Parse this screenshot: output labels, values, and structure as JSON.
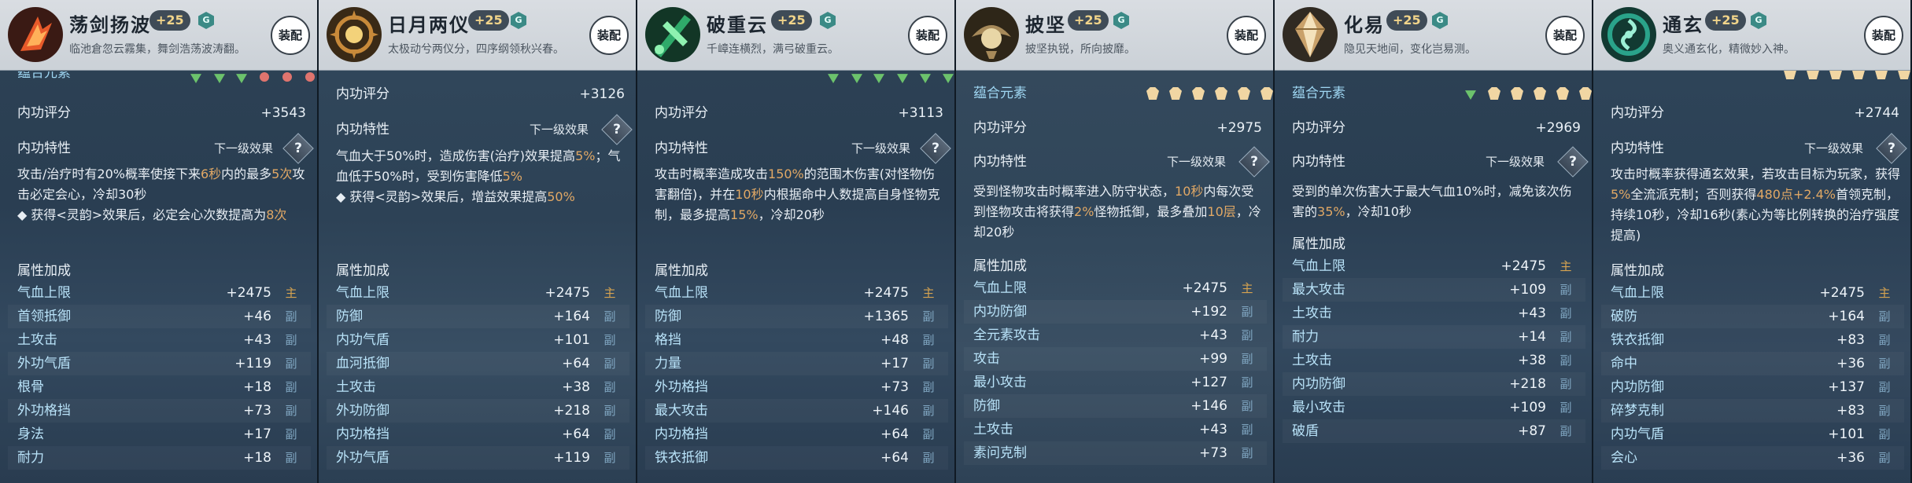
{
  "panels": [
    {
      "name": "荡剑扬波",
      "level": "+25",
      "gem": "G",
      "desc": "临池倉忽云霧集，舞剑浩荡波涛翻。",
      "equip": "装配",
      "elements_label": "蕴合元素",
      "score_label": "内功评分",
      "score": "+3543",
      "trait_label": "内功特性",
      "next_label": "下一级效果",
      "trait_text": "攻击/治疗时有20%概率使接下来6秒内的最多5次攻击必定会心，冷却30秒\n◆ 获得<灵韵>效果后，必定会心次数提高为8次",
      "attr_title": "属性加成",
      "attrs": [
        {
          "label": "气血上限",
          "value": "+2475",
          "tag": "主"
        },
        {
          "label": "首领抵御",
          "value": "+46",
          "tag": "副"
        },
        {
          "label": "土攻击",
          "value": "+43",
          "tag": "副"
        },
        {
          "label": "外功气盾",
          "value": "+119",
          "tag": "副"
        },
        {
          "label": "根骨",
          "value": "+18",
          "tag": "副"
        },
        {
          "label": "外功格挡",
          "value": "+73",
          "tag": "副"
        },
        {
          "label": "身法",
          "value": "+17",
          "tag": "副"
        },
        {
          "label": "耐力",
          "value": "+18",
          "tag": "副"
        }
      ],
      "colors": {
        "icon_a": "#e85a2a",
        "icon_b": "#ffb15a"
      }
    },
    {
      "name": "日月两仪",
      "level": "+25",
      "gem": "G",
      "desc": "太极动兮两仪分，四序纲领秋兴春。",
      "equip": "装配",
      "score_label": "内功评分",
      "score": "+3126",
      "trait_label": "内功特性",
      "next_label": "下一级效果",
      "trait_text": "气血大于50%时，造成伤害(治疗)效果提高5%；气血低于50%时，受到伤害降低5%\n◆ 获得<灵韵>效果后，增益效果提高50%",
      "attr_title": "属性加成",
      "attrs": [
        {
          "label": "气血上限",
          "value": "+2475",
          "tag": "主"
        },
        {
          "label": "防御",
          "value": "+164",
          "tag": "副"
        },
        {
          "label": "内功气盾",
          "value": "+101",
          "tag": "副"
        },
        {
          "label": "血河抵御",
          "value": "+64",
          "tag": "副"
        },
        {
          "label": "土攻击",
          "value": "+38",
          "tag": "副"
        },
        {
          "label": "外功防御",
          "value": "+218",
          "tag": "副"
        },
        {
          "label": "内功格挡",
          "value": "+64",
          "tag": "副"
        },
        {
          "label": "外功气盾",
          "value": "+119",
          "tag": "副"
        }
      ],
      "colors": {
        "icon_a": "#c88a3a",
        "icon_b": "#f3d27a"
      }
    },
    {
      "name": "破重云",
      "level": "+25",
      "gem": "G",
      "desc": "千嶂连横烈，满弓破重云。",
      "equip": "装配",
      "score_label": "内功评分",
      "score": "+3113",
      "trait_label": "内功特性",
      "next_label": "下一级效果",
      "trait_text": "攻击时概率造成攻击150%的范围木伤害(对怪物伤害翻倍)，并在10秒内根据命中人数提高自身怪物克制，最多提高15%，冷却20秒",
      "attr_title": "属性加成",
      "attrs": [
        {
          "label": "气血上限",
          "value": "+2475",
          "tag": "主"
        },
        {
          "label": "防御",
          "value": "+1365",
          "tag": "副"
        },
        {
          "label": "格挡",
          "value": "+48",
          "tag": "副"
        },
        {
          "label": "力量",
          "value": "+17",
          "tag": "副"
        },
        {
          "label": "外功格挡",
          "value": "+73",
          "tag": "副"
        },
        {
          "label": "最大攻击",
          "value": "+146",
          "tag": "副"
        },
        {
          "label": "内功格挡",
          "value": "+64",
          "tag": "副"
        },
        {
          "label": "铁衣抵御",
          "value": "+64",
          "tag": "副"
        }
      ],
      "colors": {
        "icon_a": "#2faa6a",
        "icon_b": "#8ef2b0"
      }
    },
    {
      "name": "披坚",
      "level": "+25",
      "gem": "G",
      "desc": "披坚执锐，所向披靡。",
      "equip": "装配",
      "elements_label": "蕴合元素",
      "score_label": "内功评分",
      "score": "+2975",
      "trait_label": "内功特性",
      "next_label": "下一级效果",
      "trait_text": "受到怪物攻击时概率进入防守状态，10秒内每次受到怪物攻击将获得2%怪物抵御，最多叠加10层，冷却20秒",
      "attr_title": "属性加成",
      "attrs": [
        {
          "label": "气血上限",
          "value": "+2475",
          "tag": "主"
        },
        {
          "label": "内功防御",
          "value": "+192",
          "tag": "副"
        },
        {
          "label": "全元素攻击",
          "value": "+43",
          "tag": "副"
        },
        {
          "label": "攻击",
          "value": "+99",
          "tag": "副"
        },
        {
          "label": "最小攻击",
          "value": "+127",
          "tag": "副"
        },
        {
          "label": "防御",
          "value": "+146",
          "tag": "副"
        },
        {
          "label": "土攻击",
          "value": "+43",
          "tag": "副"
        },
        {
          "label": "素问克制",
          "value": "+73",
          "tag": "副"
        }
      ],
      "colors": {
        "icon_a": "#a78a5a",
        "icon_b": "#e8d6a6"
      }
    },
    {
      "name": "化易",
      "level": "+25",
      "gem": "G",
      "desc": "隐见天地间，变化岂易测。",
      "equip": "装配",
      "elements_label": "蕴合元素",
      "score_label": "内功评分",
      "score": "+2969",
      "trait_label": "内功特性",
      "next_label": "下一级效果",
      "trait_text": "受到的单次伤害大于最大气血10%时，减免该次伤害的35%，冷却10秒",
      "attr_title": "属性加成",
      "attrs": [
        {
          "label": "气血上限",
          "value": "+2475",
          "tag": "主"
        },
        {
          "label": "最大攻击",
          "value": "+109",
          "tag": "副"
        },
        {
          "label": "土攻击",
          "value": "+43",
          "tag": "副"
        },
        {
          "label": "耐力",
          "value": "+14",
          "tag": "副"
        },
        {
          "label": "土攻击",
          "value": "+38",
          "tag": "副"
        },
        {
          "label": "内功防御",
          "value": "+218",
          "tag": "副"
        },
        {
          "label": "最小攻击",
          "value": "+109",
          "tag": "副"
        },
        {
          "label": "破盾",
          "value": "+87",
          "tag": "副"
        }
      ],
      "colors": {
        "icon_a": "#c9a16a",
        "icon_b": "#f4e2bc"
      }
    },
    {
      "name": "通玄",
      "level": "+25",
      "gem": "G",
      "desc": "奥义通玄化，精微妙入神。",
      "equip": "装配",
      "score_label": "内功评分",
      "score": "+2744",
      "trait_label": "内功特性",
      "next_label": "下一级效果",
      "trait_text": "攻击时概率获得通玄效果，若攻击目标为玩家，获得5%全流派克制；否则获得480点+2.4%首领克制，持续10秒，冷却16秒(素心为等比例转换的治疗强度提高)",
      "attr_title": "属性加成",
      "attrs": [
        {
          "label": "气血上限",
          "value": "+2475",
          "tag": "主"
        },
        {
          "label": "破防",
          "value": "+164",
          "tag": "副"
        },
        {
          "label": "铁衣抵御",
          "value": "+83",
          "tag": "副"
        },
        {
          "label": "命中",
          "value": "+36",
          "tag": "副"
        },
        {
          "label": "内功防御",
          "value": "+137",
          "tag": "副"
        },
        {
          "label": "碎梦克制",
          "value": "+83",
          "tag": "副"
        },
        {
          "label": "内功气盾",
          "value": "+101",
          "tag": "副"
        },
        {
          "label": "会心",
          "value": "+36",
          "tag": "副"
        }
      ],
      "colors": {
        "icon_a": "#2aa38a",
        "icon_b": "#9df0d6"
      }
    }
  ]
}
